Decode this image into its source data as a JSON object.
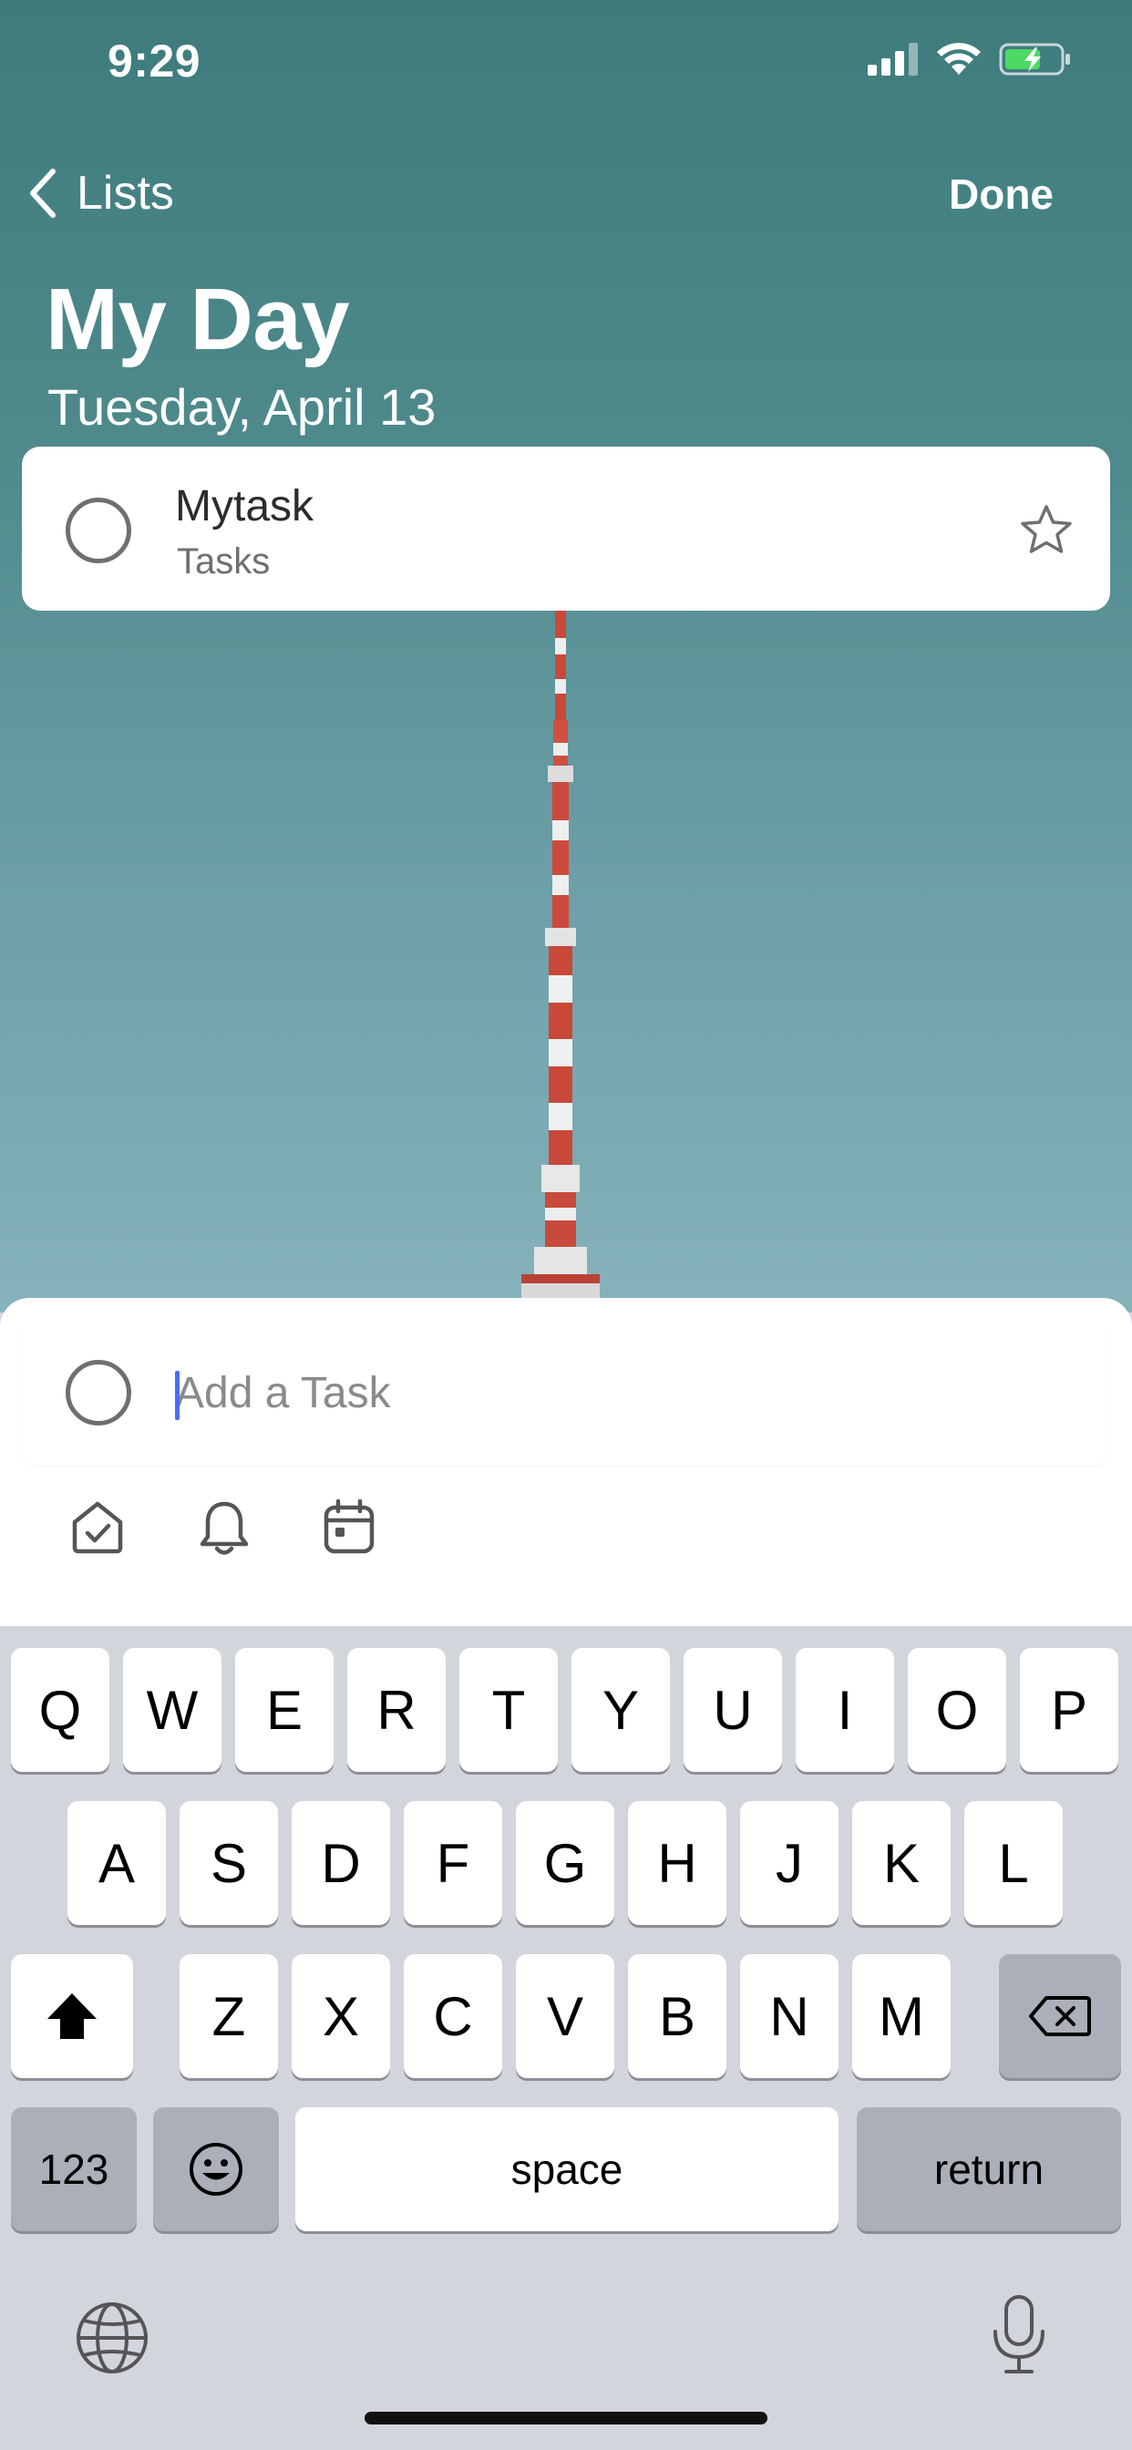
{
  "status_bar": {
    "time": "9:29",
    "icons": [
      "signal-icon",
      "wifi-icon",
      "battery-charging-icon"
    ]
  },
  "nav": {
    "back_label": "Lists",
    "done_label": "Done"
  },
  "header": {
    "title": "My Day",
    "subtitle": "Tuesday, April 13"
  },
  "tasks": [
    {
      "title": "Mytask",
      "list": "Tasks",
      "starred": false
    }
  ],
  "add_task": {
    "placeholder": "Add a Task",
    "tools": [
      "home-check-icon",
      "bell-icon",
      "calendar-icon"
    ]
  },
  "keyboard": {
    "row1": [
      "Q",
      "W",
      "E",
      "R",
      "T",
      "Y",
      "U",
      "I",
      "O",
      "P"
    ],
    "row2": [
      "A",
      "S",
      "D",
      "F",
      "G",
      "H",
      "J",
      "K",
      "L"
    ],
    "row3": [
      "Z",
      "X",
      "C",
      "V",
      "B",
      "N",
      "M"
    ],
    "numbers_label": "123",
    "space_label": "space",
    "return_label": "return"
  },
  "colors": {
    "accent_caret": "#4a6cf7",
    "background_sky": "#4f8a8d"
  }
}
